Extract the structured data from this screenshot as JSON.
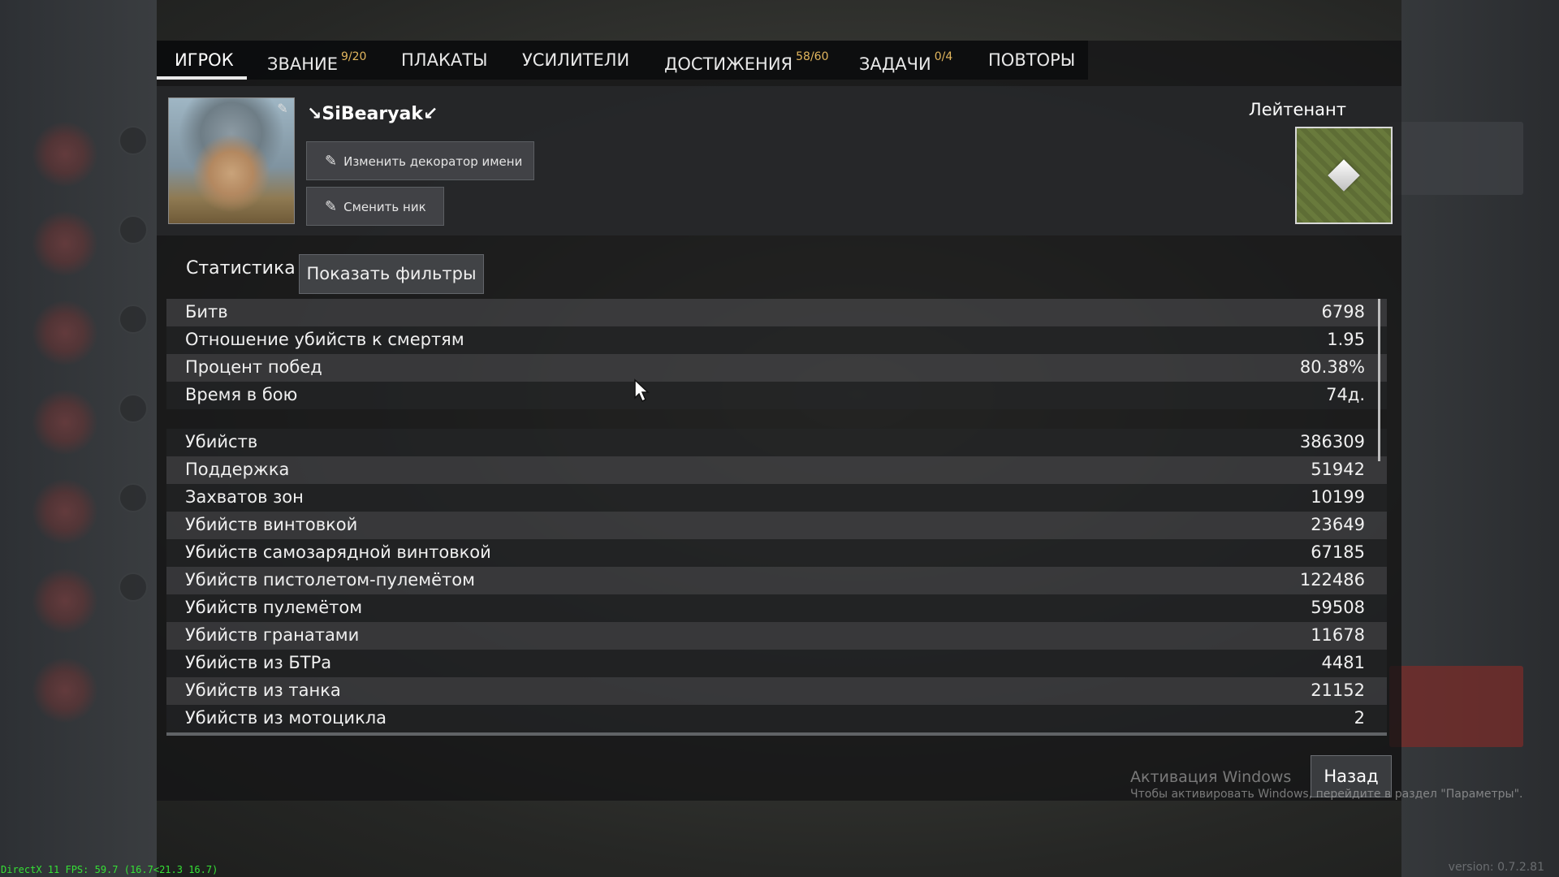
{
  "tabs": [
    {
      "label": "ИГРОК",
      "badge": ""
    },
    {
      "label": "ЗВАНИЕ",
      "badge": "9/20"
    },
    {
      "label": "ПЛАКАТЫ",
      "badge": ""
    },
    {
      "label": "УСИЛИТЕЛИ",
      "badge": ""
    },
    {
      "label": "ДОСТИЖЕНИЯ",
      "badge": "58/60"
    },
    {
      "label": "ЗАДАЧИ",
      "badge": "0/4"
    },
    {
      "label": "ПОВТОРЫ",
      "badge": ""
    }
  ],
  "profile": {
    "nickname": "↘SiBearyak↙",
    "change_decorator_label": "Изменить декоратор имени",
    "change_nick_label": "Сменить ник",
    "rank_title": "Лейтенант"
  },
  "stats": {
    "label": "Статистика",
    "filters_label": "Показать фильтры",
    "group1": [
      {
        "label": "Битв",
        "value": "6798"
      },
      {
        "label": "Отношение убийств к смертям",
        "value": "1.95"
      },
      {
        "label": "Процент побед",
        "value": "80.38%"
      },
      {
        "label": "Время в бою",
        "value": "74д."
      }
    ],
    "group2": [
      {
        "label": "Убийств",
        "value": "386309"
      },
      {
        "label": "Поддержка",
        "value": "51942"
      },
      {
        "label": "Захватов зон",
        "value": "10199"
      },
      {
        "label": "Убийств винтовкой",
        "value": "23649"
      },
      {
        "label": "Убийств самозарядной винтовкой",
        "value": "67185"
      },
      {
        "label": "Убийств пистолетом-пулемётом",
        "value": "122486"
      },
      {
        "label": "Убийств пулемётом",
        "value": "59508"
      },
      {
        "label": "Убийств гранатами",
        "value": "11678"
      },
      {
        "label": "Убийств из БТРа",
        "value": "4481"
      },
      {
        "label": "Убийств из танка",
        "value": "21152"
      },
      {
        "label": "Убийств из мотоцикла",
        "value": "2"
      }
    ]
  },
  "back_label": "Назад",
  "windows_activation": {
    "title": "Активация Windows",
    "subtitle": "Чтобы активировать Windows, перейдите в раздел \"Параметры\"."
  },
  "fps_text": "DirectX 11 FPS: 59.7 (16.7<21.3 16.7)",
  "version_text": "version: 0.7.2.81",
  "colors": {
    "badge": "#e2b65e",
    "fps": "#35e035",
    "rank_badge": "#697a3c"
  },
  "icons": {
    "edit": "pencil-icon",
    "cursor": "mouse-cursor-icon"
  }
}
